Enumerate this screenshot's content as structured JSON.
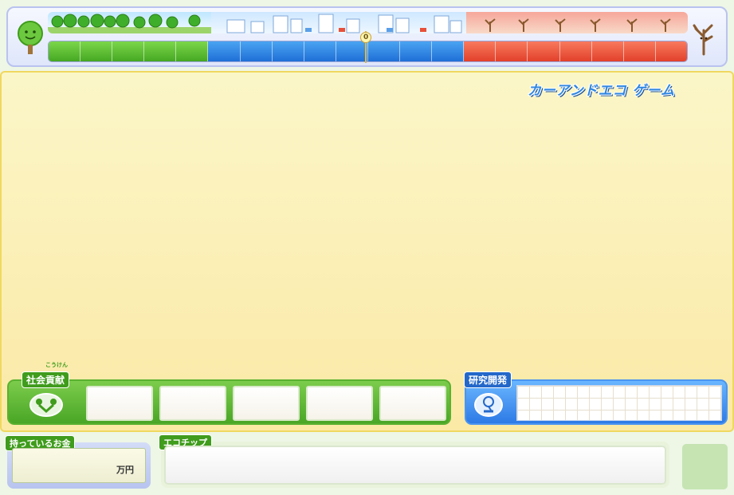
{
  "app": {
    "logo_text": "カーアンドエコ ゲーム"
  },
  "meter": {
    "marker_value": "0",
    "marker_position": 0.497,
    "segments": [
      {
        "zone": "green",
        "cells": 5
      },
      {
        "zone": "blue",
        "cells": 8
      },
      {
        "zone": "red",
        "cells": 7
      }
    ],
    "left_icon": "happy-tree-icon",
    "right_icon": "withered-tree-icon",
    "colors": {
      "green": "#45a822",
      "blue": "#1f6fd6",
      "red": "#e2402a"
    }
  },
  "social": {
    "label": "社会貢献",
    "ruby": "こうけん",
    "mascot_icon": "handshake-mascot-icon",
    "slot_count": 5
  },
  "rnd": {
    "label": "研究開発",
    "mascot_icon": "researcher-mascot-icon"
  },
  "money": {
    "label": "持っているお金",
    "value": "",
    "unit": "万円"
  },
  "ecotip": {
    "label": "エコチップ",
    "text": ""
  }
}
